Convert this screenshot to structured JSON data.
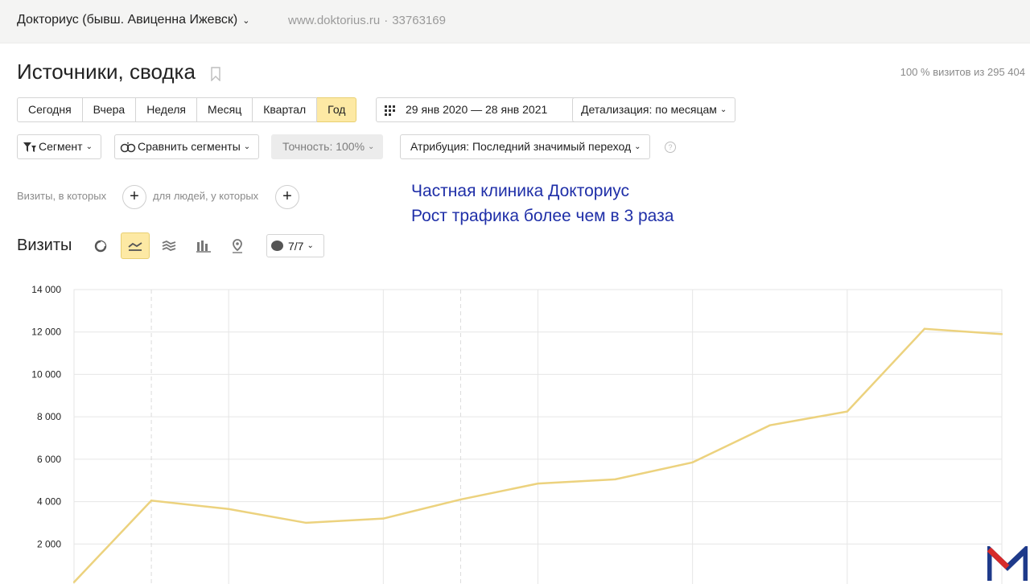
{
  "header": {
    "counter_name": "Докториус (бывш. Авиценна Ижевск)",
    "site_url": "www.doktorius.ru",
    "counter_id": "33763169"
  },
  "page": {
    "title": "Источники, сводка",
    "visits_share": "100 % визитов из 295 404"
  },
  "period_buttons": [
    {
      "label": "Сегодня",
      "active": false
    },
    {
      "label": "Вчера",
      "active": false
    },
    {
      "label": "Неделя",
      "active": false
    },
    {
      "label": "Месяц",
      "active": false
    },
    {
      "label": "Квартал",
      "active": false
    },
    {
      "label": "Год",
      "active": true
    }
  ],
  "date_range": "29 янв 2020 — 28 янв 2021",
  "detail": "Детализация: по месяцам",
  "filters": {
    "segment": "Сегмент",
    "compare": "Сравнить сегменты",
    "accuracy": "Точность: 100%",
    "attribution": "Атрибуция: Последний значимый переход"
  },
  "conditions": {
    "visits_label": "Визиты, в которых",
    "people_label": "для людей, у которых"
  },
  "annotation": {
    "line1": "Частная клиника Докториус",
    "line2": "Рост трафика более чем в 3 раза"
  },
  "chart_header": {
    "title": "Визиты",
    "series_count": "7/7"
  },
  "colors": {
    "accent": "#fde9a4",
    "line": "#ecd27e",
    "annotation": "#1f2fa8"
  },
  "chart_data": {
    "type": "line",
    "y_ticks": [
      "14 000",
      "12 000",
      "10 000",
      "8 000",
      "6 000",
      "4 000",
      "2 000"
    ],
    "ylim": [
      0,
      14000
    ],
    "x": [
      0,
      1,
      2,
      3,
      4,
      5,
      6,
      7,
      8,
      9,
      10,
      11,
      12
    ],
    "series": [
      {
        "values": [
          200,
          4050,
          3650,
          3000,
          3200,
          4100,
          4850,
          5050,
          5850,
          7600,
          8250,
          12150,
          11900
        ]
      }
    ],
    "grid": true,
    "dashed_gridlines_at_x": [
      1,
      5
    ]
  }
}
